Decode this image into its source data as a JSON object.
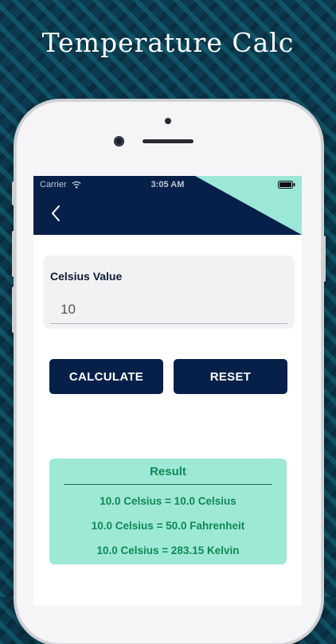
{
  "promo": {
    "title": "Temperature Calc"
  },
  "status_bar": {
    "carrier": "Carrier",
    "time": "3:05 AM"
  },
  "navbar": {
    "back_icon": "chevron-left-icon",
    "accent_color": "#9be8d8",
    "background_color": "#06204a"
  },
  "form": {
    "label": "Celsius Value",
    "input_value": "10"
  },
  "buttons": {
    "calculate_label": "CALCULATE",
    "reset_label": "RESET"
  },
  "result": {
    "title": "Result",
    "lines": [
      "10.0 Celsius = 10.0 Celsius",
      "10.0 Celsius = 50.0 Fahrenheit",
      "10.0 Celsius = 283.15 Kelvin"
    ],
    "background_color": "#9ee8d6",
    "text_color": "#0e8a55"
  }
}
